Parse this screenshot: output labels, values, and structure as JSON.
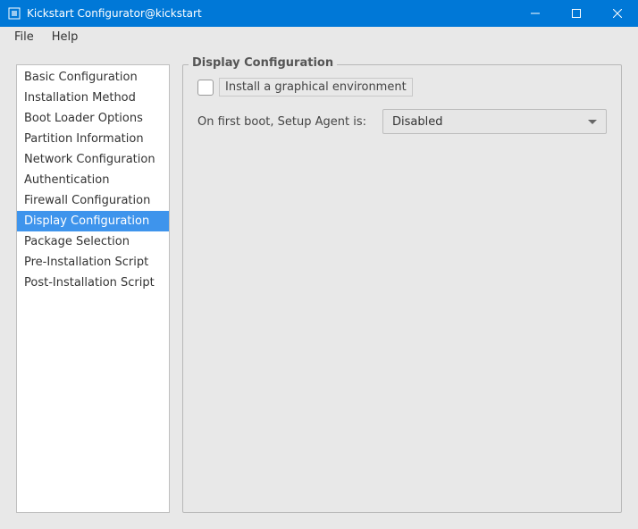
{
  "window": {
    "title": "Kickstart Configurator@kickstart"
  },
  "menubar": {
    "file": "File",
    "help": "Help"
  },
  "sidebar": {
    "items": [
      {
        "label": "Basic Configuration"
      },
      {
        "label": "Installation Method"
      },
      {
        "label": "Boot Loader Options"
      },
      {
        "label": "Partition Information"
      },
      {
        "label": "Network Configuration"
      },
      {
        "label": "Authentication"
      },
      {
        "label": "Firewall Configuration"
      },
      {
        "label": "Display Configuration"
      },
      {
        "label": "Package Selection"
      },
      {
        "label": "Pre-Installation Script"
      },
      {
        "label": "Post-Installation Script"
      }
    ],
    "selected_index": 7
  },
  "content": {
    "group_title": "Display Configuration",
    "install_graphical_label": "Install a graphical environment",
    "install_graphical_checked": false,
    "setup_agent_label": "On first boot, Setup Agent is:",
    "setup_agent_value": "Disabled"
  }
}
